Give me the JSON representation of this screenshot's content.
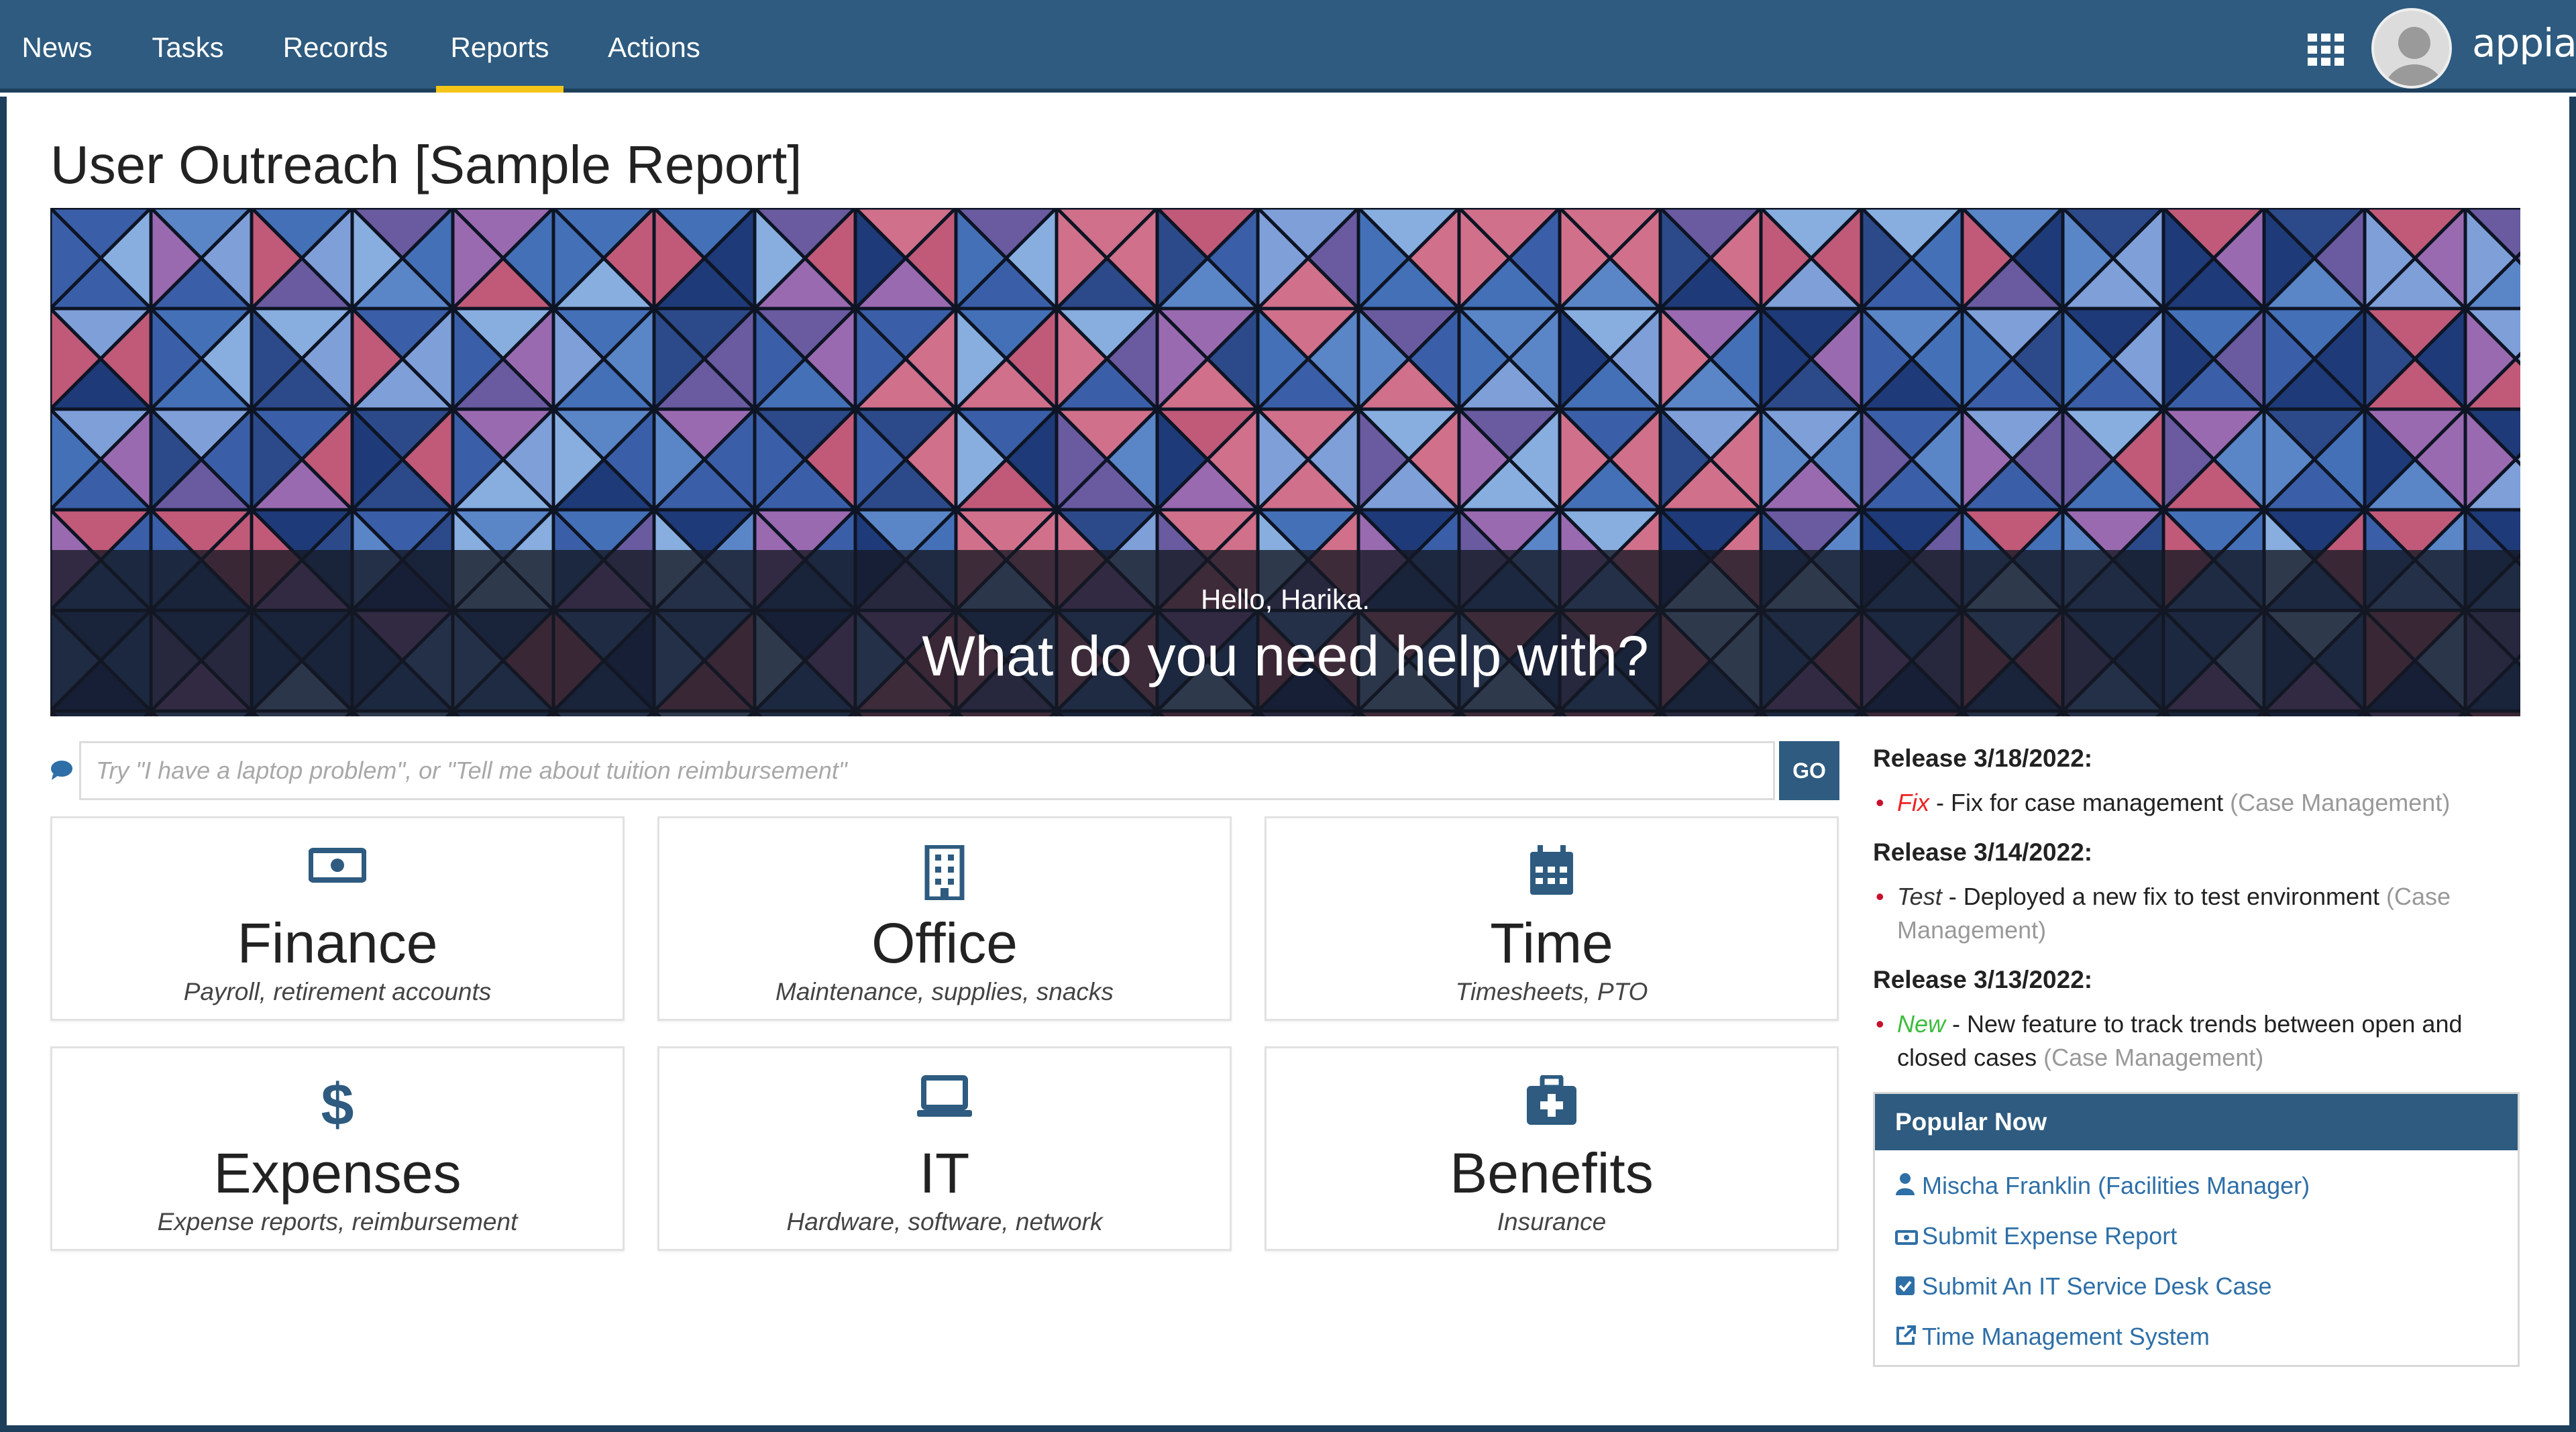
{
  "nav": {
    "items": [
      {
        "label": "News"
      },
      {
        "label": "Tasks"
      },
      {
        "label": "Records"
      },
      {
        "label": "Reports"
      },
      {
        "label": "Actions"
      }
    ],
    "active": "Reports",
    "brand": "appian"
  },
  "page": {
    "title": "User Outreach [Sample Report]"
  },
  "banner": {
    "greeting": "Hello, Harika.",
    "headline": "What do you need help with?"
  },
  "search": {
    "placeholder": "Try \"I have a laptop problem\", or \"Tell me about tuition reimbursement\"",
    "value": "",
    "go_label": "GO"
  },
  "cards": [
    {
      "title": "Finance",
      "subtitle": "Payroll, retirement accounts",
      "icon": "money-icon"
    },
    {
      "title": "Office",
      "subtitle": "Maintenance, supplies, snacks",
      "icon": "building-icon"
    },
    {
      "title": "Time",
      "subtitle": "Timesheets, PTO",
      "icon": "calendar-icon"
    },
    {
      "title": "Expenses",
      "subtitle": "Expense reports, reimbursement",
      "icon": "dollar-icon"
    },
    {
      "title": "IT",
      "subtitle": "Hardware, software, network",
      "icon": "laptop-icon"
    },
    {
      "title": "Benefits",
      "subtitle": "Insurance",
      "icon": "medkit-icon"
    }
  ],
  "releases": [
    {
      "heading": "Release 3/18/2022:",
      "tag": "Fix",
      "text": " - Fix for case management ",
      "area": "(Case Management)"
    },
    {
      "heading": "Release 3/14/2022:",
      "tag": "Test",
      "text": " - Deployed a new fix to test environment ",
      "area": "(Case Management)"
    },
    {
      "heading": "Release 3/13/2022:",
      "tag": "New",
      "text": " - New feature to track trends between open and closed cases ",
      "area": "(Case Management)"
    }
  ],
  "popular": {
    "heading": "Popular Now",
    "links": [
      {
        "label": "Mischa Franklin (Facilities Manager)",
        "icon": "user-icon"
      },
      {
        "label": "Submit Expense Report",
        "icon": "money-icon"
      },
      {
        "label": "Submit An IT Service Desk Case",
        "icon": "checkbox-icon"
      },
      {
        "label": "Time Management System",
        "icon": "external-link-icon"
      }
    ]
  },
  "colors": {
    "nav_bg": "#2e5b7f",
    "active_underline": "#f5c518",
    "link": "#2e6fa7",
    "fix": "#ee2222",
    "new": "#3cbc3c"
  }
}
